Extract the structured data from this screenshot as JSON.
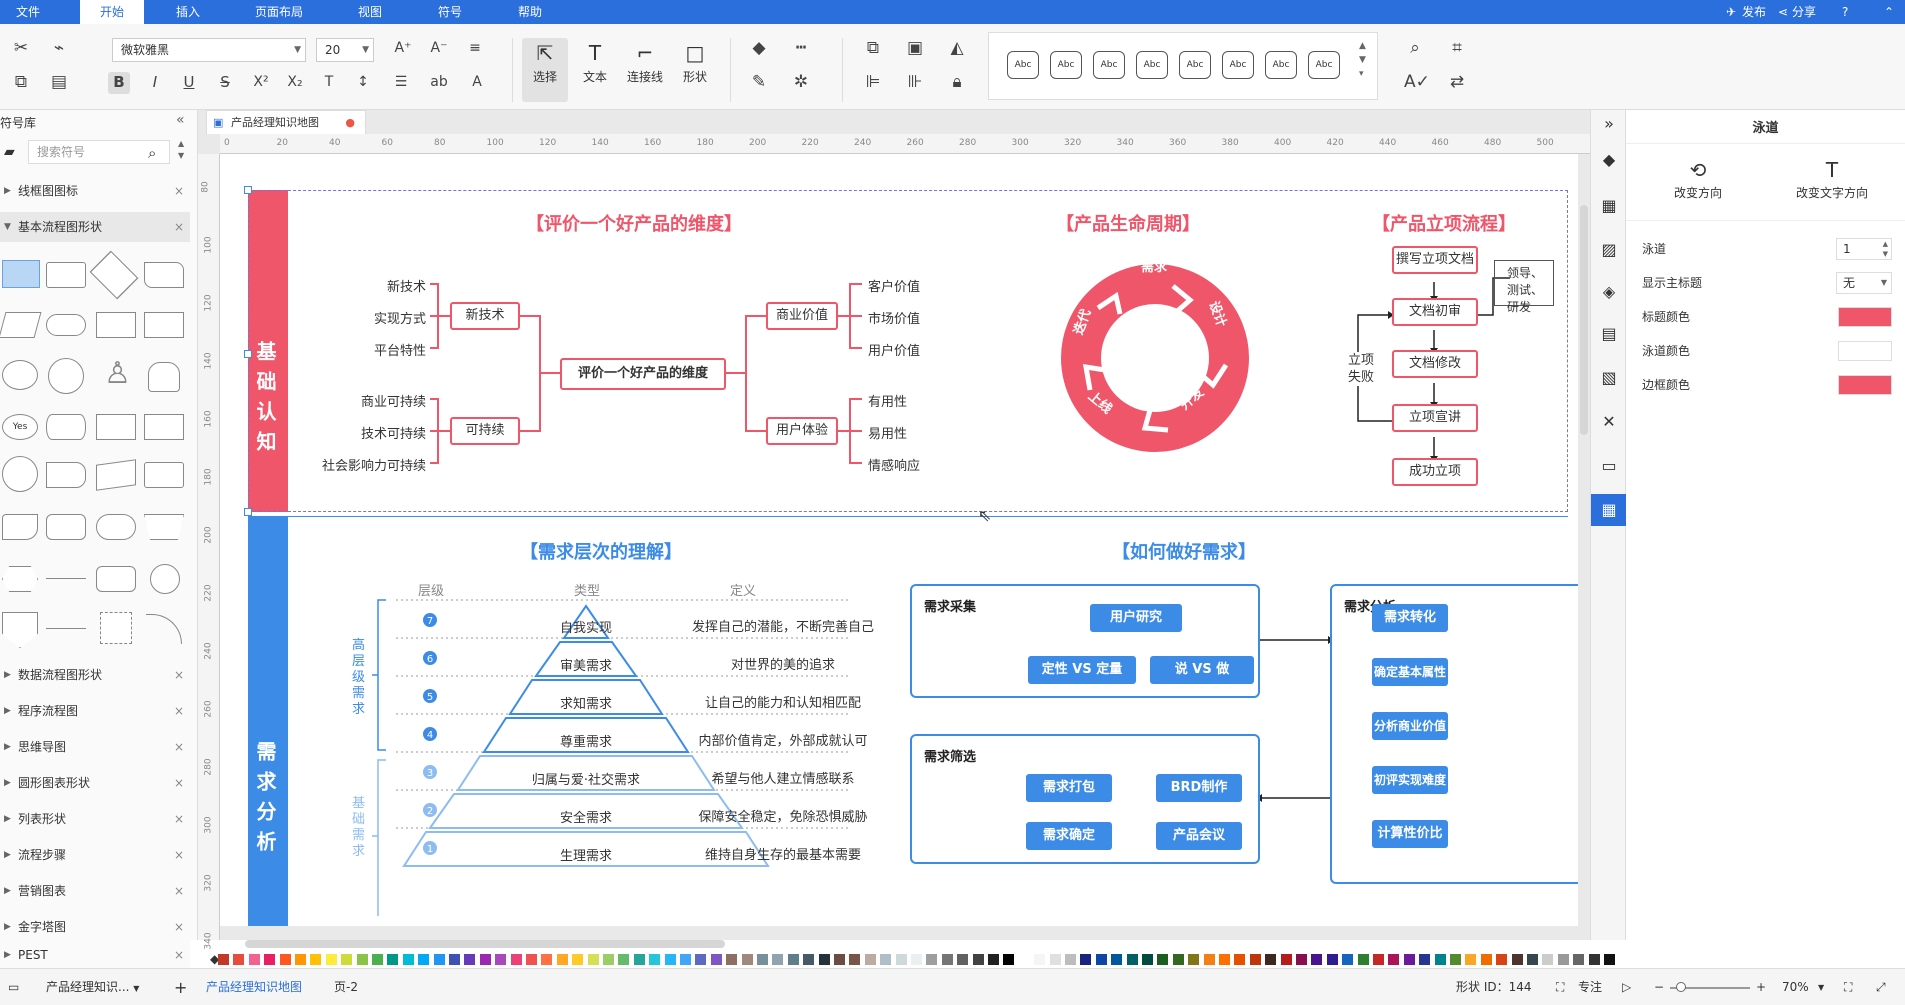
{
  "menubar": {
    "items": [
      "文件",
      "开始",
      "插入",
      "页面布局",
      "视图",
      "符号",
      "帮助"
    ],
    "publish": "发布",
    "share": "分享",
    "help": "?"
  },
  "toolbar": {
    "font": "微软雅黑",
    "size": "20",
    "select": "选择",
    "text": "文本",
    "connector": "连接线",
    "shape": "形状",
    "style_sample": "Abc"
  },
  "sidebar": {
    "title": "符号库",
    "search_placeholder": "搜索符号",
    "cats_top": [
      "线框图图标",
      "基本流程图形状"
    ],
    "shape_yes": "Yes",
    "cats_bottom": [
      "数据流程图形状",
      "程序流程图",
      "思维导图",
      "圆形图表形状",
      "列表形状",
      "流程步骤",
      "营销图表",
      "金字塔图",
      "PEST"
    ]
  },
  "doc_tab": "产品经理知识地图",
  "ruler": {
    "h": [
      "0",
      "20",
      "40",
      "60",
      "80",
      "100",
      "120",
      "140",
      "160",
      "180",
      "200",
      "220",
      "240",
      "260",
      "280",
      "300",
      "320",
      "340",
      "360",
      "380",
      "400",
      "420",
      "440",
      "460",
      "480",
      "500"
    ],
    "v": [
      "80",
      "100",
      "120",
      "140",
      "160",
      "180",
      "200",
      "220",
      "240",
      "260",
      "280",
      "300",
      "320",
      "340"
    ]
  },
  "lane1": {
    "header": "基础认知",
    "dim_title": "【评价一个好产品的维度】",
    "center": "评价一个好产品的维度",
    "new_tech": "新技术",
    "sustain": "可持续",
    "biz_value": "商业价值",
    "ux": "用户体验",
    "nt_items": [
      "新技术",
      "实现方式",
      "平台特性"
    ],
    "su_items": [
      "商业可持续",
      "技术可持续",
      "社会影响力可持续"
    ],
    "bv_items": [
      "客户价值",
      "市场价值",
      "用户价值"
    ],
    "ux_items": [
      "有用性",
      "易用性",
      "情感响应"
    ],
    "life_title": "【产品生命周期】",
    "life": [
      "需求",
      "设计",
      "开发",
      "上线",
      "迭代"
    ],
    "proj_title": "【产品立项流程】",
    "proj": [
      "撰写立项文档",
      "文档初审",
      "文档修改",
      "立项宣讲",
      "成功立项"
    ],
    "proj_fail": "立项失败",
    "proj_note": "领导、测试、研发"
  },
  "lane2": {
    "header": "需求分析",
    "level_title": "【需求层次的理解】",
    "cols": [
      "层级",
      "类型",
      "定义"
    ],
    "high": "高层级需求",
    "base": "基础需求",
    "levels": [
      {
        "n": "7",
        "type": "自我实现",
        "def": "发挥自己的潜能，不断完善自己"
      },
      {
        "n": "6",
        "type": "审美需求",
        "def": "对世界的美的追求"
      },
      {
        "n": "5",
        "type": "求知需求",
        "def": "让自己的能力和认知相匹配"
      },
      {
        "n": "4",
        "type": "尊重需求",
        "def": "内部价值肯定，外部成就认可"
      },
      {
        "n": "3",
        "type": "归属与爱·社交需求",
        "def": "希望与他人建立情感联系"
      },
      {
        "n": "2",
        "type": "安全需求",
        "def": "保障安全稳定，免除恐惧威胁"
      },
      {
        "n": "1",
        "type": "生理需求",
        "def": "维持自身生存的最基本需要"
      }
    ],
    "how_title": "【如何做好需求】",
    "collect": "需求采集",
    "user_research": "用户研究",
    "qual": "定性 VS 定量",
    "say_do": "说 VS 做",
    "filter": "需求筛选",
    "pack": "需求打包",
    "brd": "BRD制作",
    "confirm": "需求确定",
    "meeting": "产品会议",
    "analysis": "需求分析",
    "a_steps": [
      "需求转化",
      "确定基本属性",
      "分析商业价值",
      "初评实现难度",
      "计算性价比"
    ]
  },
  "right": {
    "title": "泳道",
    "change_dir": "改变方向",
    "change_text_dir": "改变文字方向",
    "lane_lbl": "泳道",
    "lane_val": "1",
    "show_title_lbl": "显示主标题",
    "show_title_val": "无",
    "title_color_lbl": "标题颜色",
    "lane_color_lbl": "泳道颜色",
    "border_color_lbl": "边框颜色"
  },
  "colors": {
    "accent": "#2a6fdb",
    "red": "#f0566a",
    "blue": "#3c8ce7"
  },
  "bottom": {
    "page_list": "产品经理知识...",
    "active_page": "产品经理知识地图",
    "page2": "页-2",
    "shape_id": "形状 ID：144",
    "focus": "专注",
    "zoom": "70%",
    "add": "+"
  }
}
